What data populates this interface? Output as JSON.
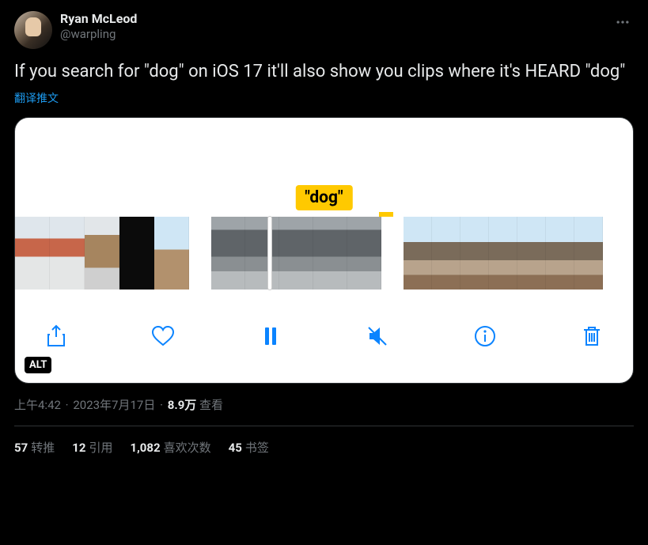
{
  "author": {
    "display_name": "Ryan McLeod",
    "handle": "@warpling"
  },
  "tweet_text": "If you search for \"dog\" on iOS 17 it'll also show you clips where it's HEARD \"dog\"",
  "translate_label": "翻译推文",
  "media": {
    "search_term_label": "\"dog\"",
    "alt_badge": "ALT"
  },
  "meta": {
    "time": "上午4:42",
    "date": "2023年7月17日",
    "views_number": "8.9万",
    "views_label": "查看"
  },
  "stats": {
    "retweets_num": "57",
    "retweets_label": "转推",
    "quotes_num": "12",
    "quotes_label": "引用",
    "likes_num": "1,082",
    "likes_label": "喜欢次数",
    "bookmarks_num": "45",
    "bookmarks_label": "书签"
  }
}
